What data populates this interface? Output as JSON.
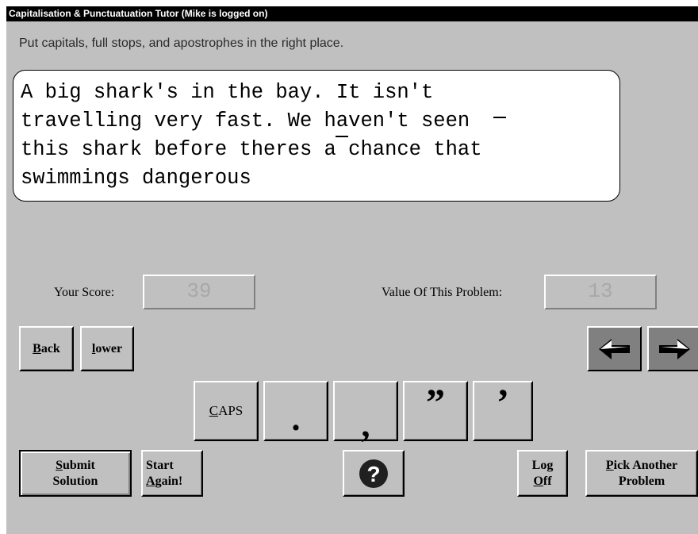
{
  "window": {
    "title": "Capitalisation & Punctuatuation Tutor (Mike is logged on)"
  },
  "instruction": "Put capitals, full stops, and apostrophes in the right place.",
  "sentence": {
    "lines": [
      "A big shark's in the bay. It isn't",
      "travelling very fast. We haven't seen",
      "this shark before theres a chance that",
      "swimmings dangerous"
    ]
  },
  "score": {
    "label": "Your Score:",
    "value": "39"
  },
  "problem_value": {
    "label": "Value Of This Problem:",
    "value": "13"
  },
  "buttons": {
    "back": {
      "accel": "B",
      "rest": "ack"
    },
    "lower": {
      "accel": "l",
      "rest": "ower"
    },
    "caps": {
      "accel": "C",
      "rest": "APS"
    },
    "full_stop": ".",
    "comma": ",",
    "double_quote": "”",
    "apostrophe": "’",
    "submit": {
      "accel": "S",
      "line1_rest": "ubmit",
      "line2": "Solution"
    },
    "start_again": {
      "line1": "Start",
      "accel": "A",
      "line2_rest": "gain!"
    },
    "help": "?",
    "log_off": {
      "line1": "Log",
      "accel": "O",
      "line2_rest": "ff"
    },
    "pick_another": {
      "accel": "P",
      "line1_rest": "ick Another",
      "line2": "Problem"
    },
    "left_arrow": "left-arrow-icon",
    "right_arrow": "right-arrow-icon"
  },
  "colors": {
    "window_bg": "#c0c0c0",
    "titlebar_bg": "#000000",
    "arrow_button_bg": "#808080",
    "field_text": "#a8a8a8"
  }
}
